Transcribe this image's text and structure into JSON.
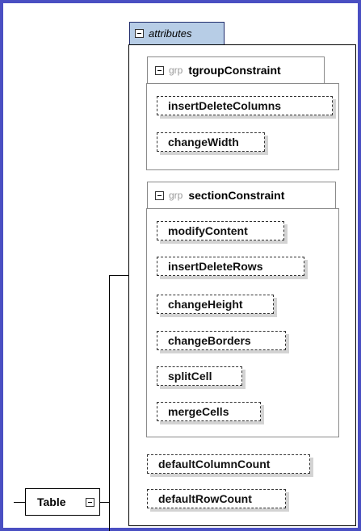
{
  "attributes": {
    "label": "attributes",
    "groups": [
      {
        "grp_word": "grp",
        "name": "tgroupConstraint",
        "items": [
          "insertDeleteColumns",
          "changeWidth"
        ]
      },
      {
        "grp_word": "grp",
        "name": "sectionConstraint",
        "items": [
          "modifyContent",
          "insertDeleteRows",
          "changeHeight",
          "changeBorders",
          "splitCell",
          "mergeCells"
        ]
      }
    ],
    "items": [
      "defaultColumnCount",
      "defaultRowCount"
    ]
  },
  "element": {
    "name": "Table"
  },
  "colors": {
    "frame": "#4a4fc2",
    "attributes_tab": "#b7cde6"
  },
  "icons": [
    "collapse-icon"
  ]
}
